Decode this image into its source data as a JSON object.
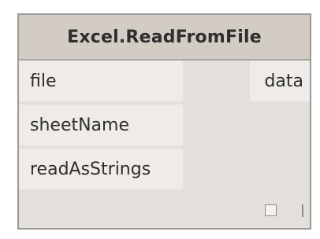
{
  "node": {
    "title": "Excel.ReadFromFile",
    "inputs": [
      {
        "label": "file"
      },
      {
        "label": "sheetName"
      },
      {
        "label": "readAsStrings"
      }
    ],
    "outputs": [
      {
        "label": "data"
      }
    ]
  },
  "icons": {
    "lacing_checkbox": "checkbox-icon",
    "lacing_indicator": "lacing-indicator-icon"
  }
}
